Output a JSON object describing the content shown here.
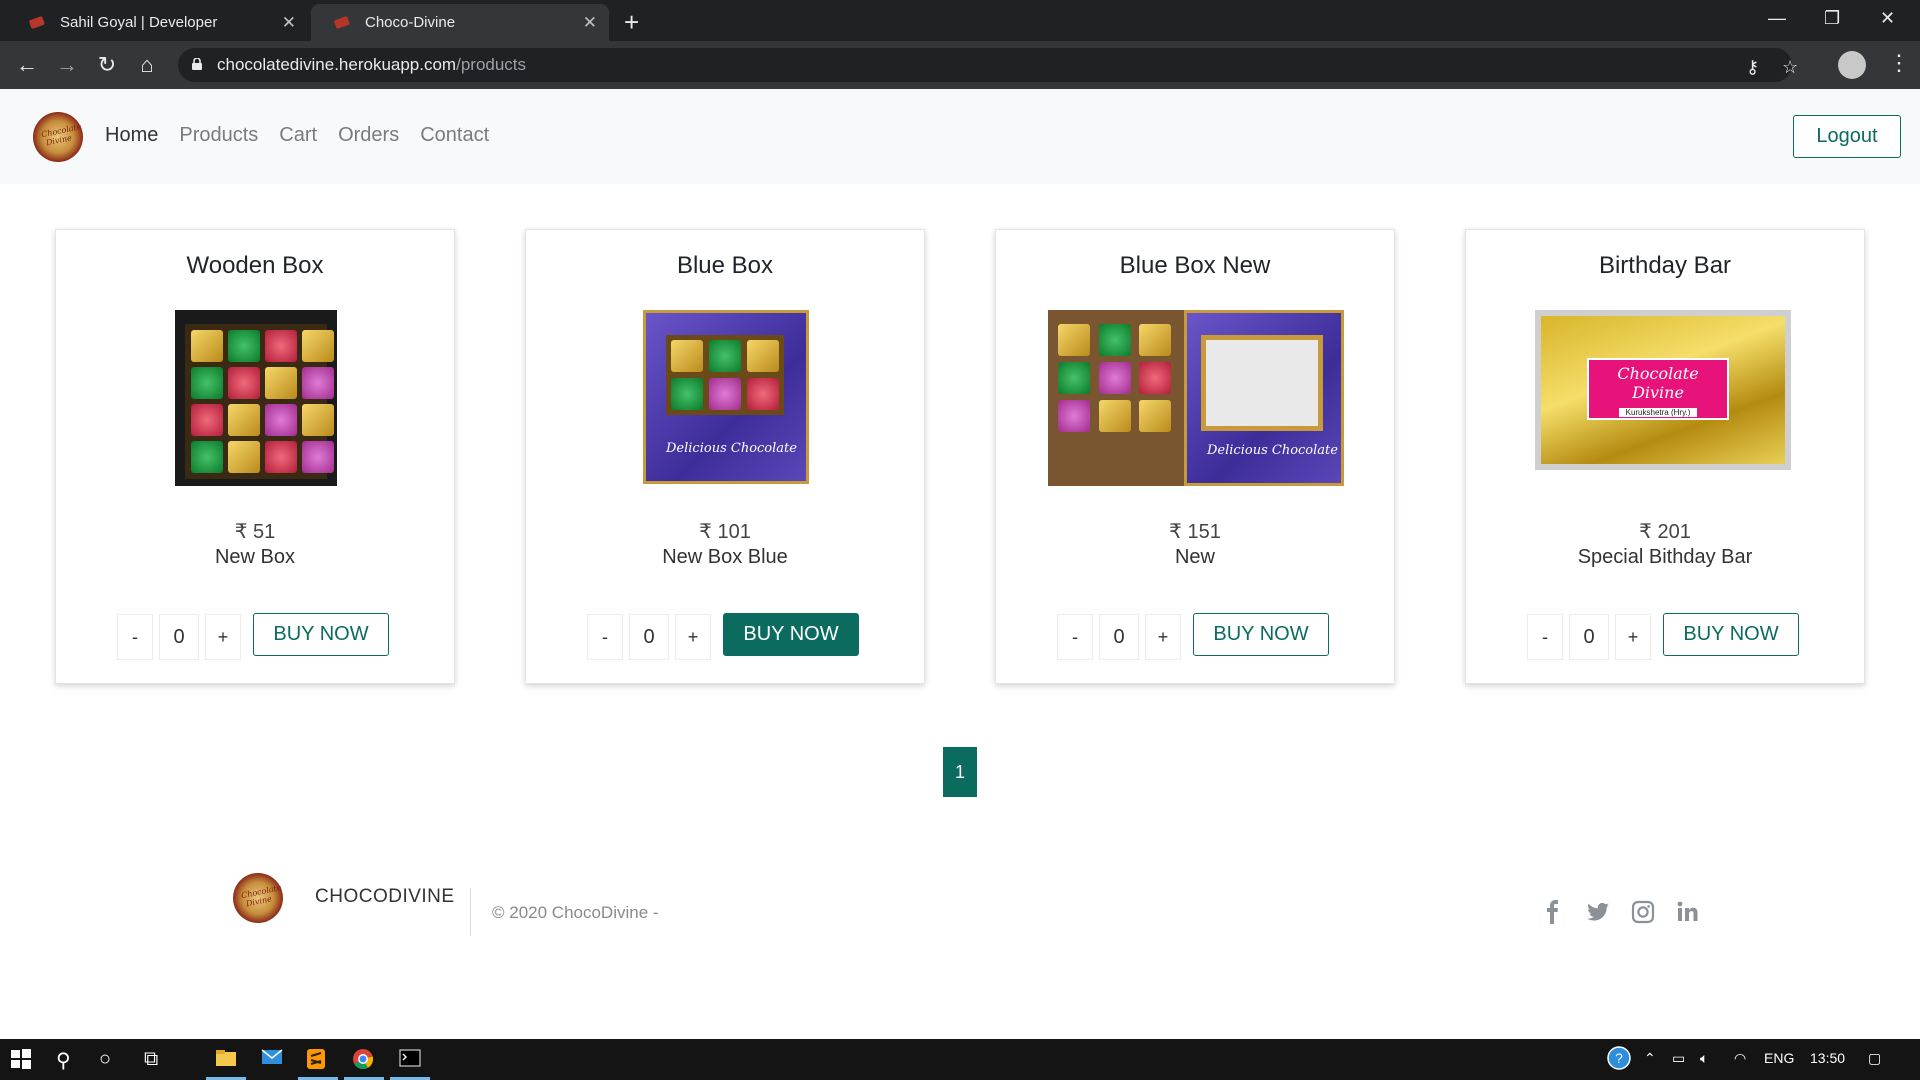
{
  "browser": {
    "tabs": [
      {
        "title": "Sahil Goyal | Developer"
      },
      {
        "title": "Choco-Divine"
      }
    ],
    "url_host": "chocolatedivine.herokuapp.com",
    "url_path": "/products"
  },
  "site": {
    "logo_text": "Chocolate Divine",
    "nav": [
      {
        "label": "Home"
      },
      {
        "label": "Products"
      },
      {
        "label": "Cart"
      },
      {
        "label": "Orders"
      },
      {
        "label": "Contact"
      }
    ],
    "logout_label": "Logout"
  },
  "products": [
    {
      "title": "Wooden Box",
      "price": "₹ 51",
      "description": "New Box",
      "quantity": "0",
      "buy_label": "BUY NOW"
    },
    {
      "title": "Blue Box",
      "price": "₹ 101",
      "description": "New Box Blue",
      "quantity": "0",
      "buy_label": "BUY NOW"
    },
    {
      "title": "Blue Box New",
      "price": "₹ 151",
      "description": "New",
      "quantity": "0",
      "buy_label": "BUY NOW"
    },
    {
      "title": "Birthday Bar",
      "price": "₹ 201",
      "description": "Special Bithday Bar",
      "quantity": "0",
      "buy_label": "BUY NOW"
    }
  ],
  "product_images": {
    "bar_label": "Chocolate Divine",
    "bar_sublabel": "Kurukshetra (Hry.)",
    "box_label": "Delicious Chocolate"
  },
  "controls": {
    "minus": "-",
    "plus": "+"
  },
  "pagination": {
    "current": "1"
  },
  "footer": {
    "brand": "CHOCODIVINE",
    "copyright": "© 2020 ChocoDivine -"
  },
  "taskbar": {
    "language": "ENG",
    "time": "13:50"
  },
  "colors": {
    "accent": "#0b6b5f",
    "chrome_dark": "#202124",
    "header_bg": "#f8f9fa"
  }
}
